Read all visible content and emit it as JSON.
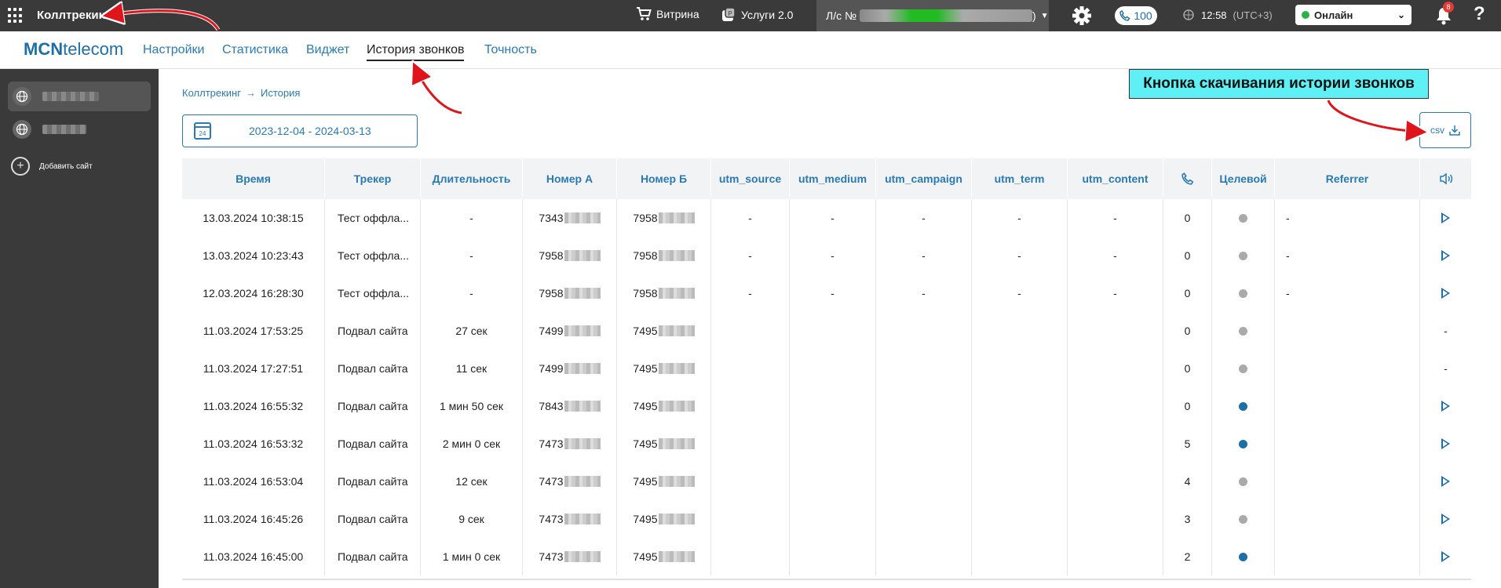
{
  "topbar": {
    "app_title": "Коллтрекинг",
    "showcase_label": "Витрина",
    "services_label": "Услуги 2.0",
    "account_prefix": "Л/с №",
    "account_suffix": ")",
    "calls_count": "100",
    "time": "12:58",
    "timezone": "(UTC+3)",
    "status_value": "Онлайн",
    "notifications_count": "8",
    "help_label": "?"
  },
  "navbar": {
    "logo_bold": "MCN",
    "logo_rest": "telecom",
    "links": [
      "Настройки",
      "Статистика",
      "Виджет",
      "История звонков",
      "Точность"
    ],
    "active_index": 3
  },
  "sidebar": {
    "add_site_label": "Добавить сайт"
  },
  "breadcrumb": {
    "root": "Коллтрекинг",
    "separator": "→",
    "current": "История"
  },
  "date_range": {
    "calendar_day": "24",
    "value": "2023-12-04 - 2024-03-13"
  },
  "annotation_text": "Кнопка скачивания истории звонков",
  "csv_button_label": "csv",
  "table": {
    "headers": {
      "time": "Время",
      "tracker": "Трекер",
      "duration": "Длительность",
      "number_a": "Номер А",
      "number_b": "Номер Б",
      "utm_source": "utm_source",
      "utm_medium": "utm_medium",
      "utm_campaign": "utm_campaign",
      "utm_term": "utm_term",
      "utm_content": "utm_content",
      "target": "Целевой",
      "referrer": "Referrer"
    },
    "rows": [
      {
        "time": "13.03.2024 10:38:15",
        "tracker": "Тест оффла...",
        "duration": "-",
        "number_a": "7343",
        "number_b": "7958",
        "utm_source": "-",
        "utm_medium": "-",
        "utm_campaign": "-",
        "utm_term": "-",
        "utm_content": "-",
        "count": "0",
        "target": false,
        "referrer": "-",
        "record": "-"
      },
      {
        "time": "13.03.2024 10:23:43",
        "tracker": "Тест оффла...",
        "duration": "-",
        "number_a": "7958",
        "number_b": "7958",
        "utm_source": "-",
        "utm_medium": "-",
        "utm_campaign": "-",
        "utm_term": "-",
        "utm_content": "-",
        "count": "0",
        "target": false,
        "referrer": "-",
        "record": "-"
      },
      {
        "time": "12.03.2024 16:28:30",
        "tracker": "Тест оффла...",
        "duration": "-",
        "number_a": "7958",
        "number_b": "7958",
        "utm_source": "-",
        "utm_medium": "-",
        "utm_campaign": "-",
        "utm_term": "-",
        "utm_content": "-",
        "count": "0",
        "target": false,
        "referrer": "-",
        "record": "-"
      },
      {
        "time": "11.03.2024 17:53:25",
        "tracker": "Подвал сайта",
        "duration": "27 сек",
        "number_a": "7499",
        "number_b": "7495",
        "utm_source": "",
        "utm_medium": "",
        "utm_campaign": "",
        "utm_term": "",
        "utm_content": "",
        "count": "0",
        "target": false,
        "referrer": "",
        "record": "-"
      },
      {
        "time": "11.03.2024 17:27:51",
        "tracker": "Подвал сайта",
        "duration": "11 сек",
        "number_a": "7499",
        "number_b": "7495",
        "utm_source": "",
        "utm_medium": "",
        "utm_campaign": "",
        "utm_term": "",
        "utm_content": "",
        "count": "0",
        "target": false,
        "referrer": "",
        "record": "-"
      },
      {
        "time": "11.03.2024 16:55:32",
        "tracker": "Подвал сайта",
        "duration": "1 мин 50 сек",
        "number_a": "7843",
        "number_b": "7495",
        "utm_source": "",
        "utm_medium": "",
        "utm_campaign": "",
        "utm_term": "",
        "utm_content": "",
        "count": "0",
        "target": true,
        "referrer": "",
        "record": "-"
      },
      {
        "time": "11.03.2024 16:53:32",
        "tracker": "Подвал сайта",
        "duration": "2 мин 0 сек",
        "number_a": "7473",
        "number_b": "7495",
        "utm_source": "",
        "utm_medium": "",
        "utm_campaign": "",
        "utm_term": "",
        "utm_content": "",
        "count": "5",
        "target": true,
        "referrer": "",
        "record": "-"
      },
      {
        "time": "11.03.2024 16:53:04",
        "tracker": "Подвал сайта",
        "duration": "12 сек",
        "number_a": "7473",
        "number_b": "7495",
        "utm_source": "",
        "utm_medium": "",
        "utm_campaign": "",
        "utm_term": "",
        "utm_content": "",
        "count": "4",
        "target": false,
        "referrer": "",
        "record": "-"
      },
      {
        "time": "11.03.2024 16:45:26",
        "tracker": "Подвал сайта",
        "duration": "9 сек",
        "number_a": "7473",
        "number_b": "7495",
        "utm_source": "",
        "utm_medium": "",
        "utm_campaign": "",
        "utm_term": "",
        "utm_content": "",
        "count": "3",
        "target": false,
        "referrer": "",
        "record": "-"
      },
      {
        "time": "11.03.2024 16:45:00",
        "tracker": "Подвал сайта",
        "duration": "1 мин 0 сек",
        "number_a": "7473",
        "number_b": "7495",
        "utm_source": "",
        "utm_medium": "",
        "utm_campaign": "",
        "utm_term": "",
        "utm_content": "",
        "count": "2",
        "target": true,
        "referrer": "",
        "record": "-"
      }
    ],
    "playable_rows": [
      0,
      1,
      2,
      5,
      6,
      7,
      8,
      9
    ]
  },
  "colors": {
    "topbar_bg": "#3a3a3a",
    "accent": "#2a7ab5",
    "target_dot": "#1d6fa5",
    "non_target_dot": "#aaaaaa",
    "annotation_bg": "#5ef0f5",
    "annotation_arrow": "#e0141b"
  }
}
